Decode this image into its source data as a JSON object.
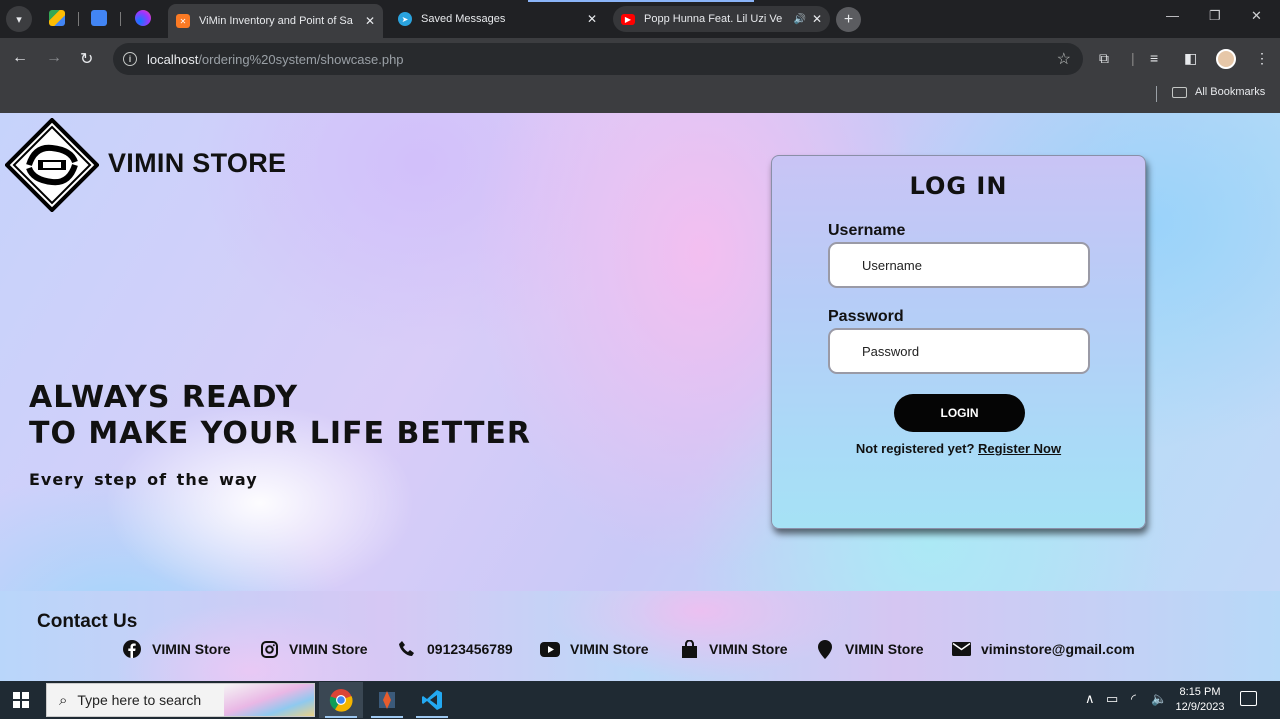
{
  "browser": {
    "tabs": [
      {
        "title": "ViMin Inventory and Point of Sa",
        "active": true,
        "favicon": "xampp-icon",
        "color": "#fb7a24"
      },
      {
        "title": "Saved Messages",
        "active": false,
        "favicon": "telegram-icon",
        "color": "#2aa3de"
      },
      {
        "title": "Popp Hunna Feat. Lil Uzi Ve",
        "active": false,
        "favicon": "youtube-icon",
        "color": "#ff0000"
      }
    ],
    "url_host": "localhost",
    "url_path": "/ordering%20system/showcase.php",
    "bookmarks_label": "All Bookmarks"
  },
  "page": {
    "brand": "VIMIN STORE",
    "hero_line1": "ALWAYS READY",
    "hero_line2": "TO MAKE YOUR LIFE BETTER",
    "hero_sub": "Every step of the way",
    "login": {
      "title": "LOG IN",
      "username_label": "Username",
      "username_placeholder": "Username",
      "password_label": "Password",
      "password_placeholder": "Password",
      "button": "LOGIN",
      "register_prompt": "Not registered yet?",
      "register_link": "Register Now"
    },
    "contact": {
      "title": "Contact Us",
      "items": [
        {
          "icon": "facebook-icon",
          "text": "VIMIN Store"
        },
        {
          "icon": "instagram-icon",
          "text": "VIMIN Store"
        },
        {
          "icon": "phone-icon",
          "text": "09123456789"
        },
        {
          "icon": "youtube-icon",
          "text": "VIMIN Store"
        },
        {
          "icon": "shopping-bag-icon",
          "text": "VIMIN Store"
        },
        {
          "icon": "location-pin-icon",
          "text": "VIMIN Store"
        },
        {
          "icon": "envelope-icon",
          "text": "viminstore@gmail.com"
        }
      ]
    }
  },
  "taskbar": {
    "search_placeholder": "Type here to search",
    "time": "8:15 PM",
    "date": "12/9/2023"
  }
}
